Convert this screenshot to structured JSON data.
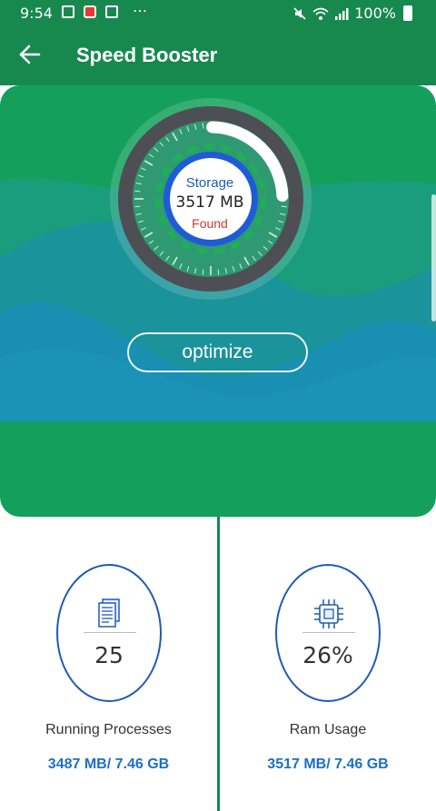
{
  "status_bar": {
    "time": "9:54",
    "battery": "100%",
    "more": "⋯",
    "icons": [
      "gallery-icon",
      "notification-red-icon",
      "work-icon",
      "mute-icon",
      "wifi-icon",
      "signal-icon",
      "battery-icon"
    ]
  },
  "app_bar": {
    "title": "Speed Booster",
    "back_icon": "back-arrow-icon"
  },
  "gauge": {
    "label": "Storage",
    "value": "3517 MB",
    "status": "Found",
    "fill_fraction": 0.24
  },
  "optimize_label": "optimize",
  "cards": [
    {
      "icon": "document-icon",
      "value": "25",
      "label": "Running Processes",
      "memory": "3487 MB/ 7.46 GB"
    },
    {
      "icon": "chip-icon",
      "value": "26%",
      "label": "Ram Usage",
      "memory": "3517 MB/ 7.46 GB"
    }
  ],
  "colors": {
    "primary": "#17894f",
    "hero": "#14a05c",
    "accent_blue": "#1e5bb5",
    "found_red": "#d23a2e"
  }
}
